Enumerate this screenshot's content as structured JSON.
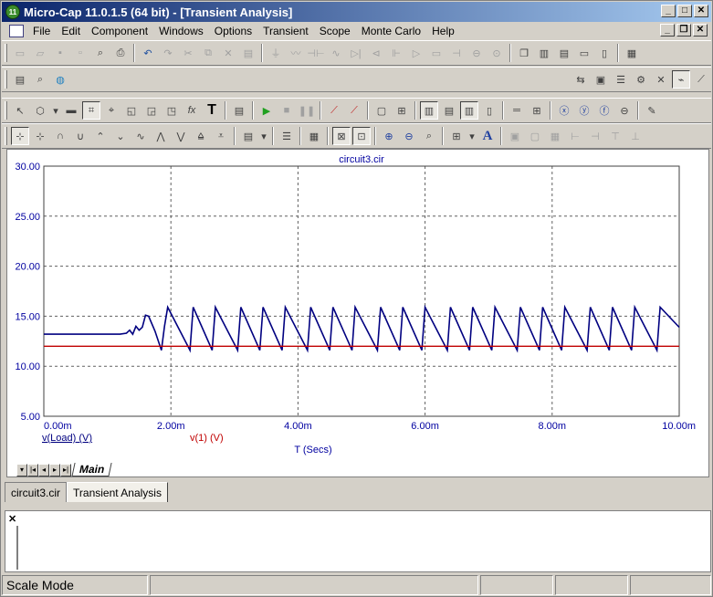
{
  "window": {
    "title": "Micro-Cap 11.0.1.5 (64 bit) - [Transient Analysis]",
    "app_icon_text": "11"
  },
  "menu": {
    "items": [
      "File",
      "Edit",
      "Component",
      "Windows",
      "Options",
      "Transient",
      "Scope",
      "Monte Carlo",
      "Help"
    ]
  },
  "plot": {
    "title": "circuit3.cir",
    "x_axis_label": "T (Secs)",
    "y_ticks": [
      "30.00",
      "25.00",
      "20.00",
      "15.00",
      "10.00",
      "5.00"
    ],
    "x_ticks": [
      "0.00m",
      "2.00m",
      "4.00m",
      "6.00m",
      "8.00m",
      "10.00m"
    ],
    "legend": [
      {
        "label": "v(Load) (V)",
        "color": "#000080"
      },
      {
        "label": "v(1) (V)",
        "color": "#c00000"
      }
    ],
    "tab_label": "Main"
  },
  "chart_data": {
    "type": "line",
    "title": "circuit3.cir",
    "xlabel": "T (Secs)",
    "ylabel": "",
    "xlim": [
      0,
      10
    ],
    "ylim": [
      5,
      30
    ],
    "x_unit": "ms",
    "grid": true,
    "series": [
      {
        "name": "v(Load) (V)",
        "color": "#000080",
        "x": [
          0,
          1.2,
          1.3,
          1.35,
          1.4,
          1.45,
          1.5,
          1.55,
          1.6,
          1.65,
          1.75,
          1.85,
          1.9,
          1.95,
          2.3,
          2.35,
          2.65,
          2.7,
          3.05,
          3.1,
          3.4,
          3.45,
          3.75,
          3.8,
          4.15,
          4.2,
          4.5,
          4.55,
          4.85,
          4.9,
          5.25,
          5.3,
          5.6,
          5.65,
          5.95,
          6.0,
          6.35,
          6.4,
          6.7,
          6.75,
          7.05,
          7.1,
          7.45,
          7.5,
          7.8,
          7.85,
          8.15,
          8.2,
          8.55,
          8.6,
          8.9,
          8.95,
          9.25,
          9.3,
          9.65,
          9.7,
          10.0
        ],
        "values": [
          13.2,
          13.2,
          13.3,
          13.6,
          13.2,
          14.0,
          13.6,
          13.9,
          15.1,
          15.0,
          13.5,
          11.6,
          14.0,
          15.9,
          11.6,
          15.9,
          11.6,
          15.9,
          11.6,
          15.9,
          11.6,
          15.9,
          11.6,
          15.9,
          11.6,
          15.9,
          11.6,
          15.9,
          11.6,
          15.9,
          11.6,
          15.9,
          11.6,
          15.9,
          11.6,
          15.9,
          11.6,
          15.9,
          11.6,
          15.9,
          11.6,
          15.9,
          11.6,
          15.9,
          11.6,
          15.9,
          11.6,
          15.9,
          11.6,
          15.9,
          11.6,
          15.9,
          11.6,
          15.9,
          11.6,
          15.9,
          13.9
        ]
      },
      {
        "name": "v(1) (V)",
        "color": "#c00000",
        "x": [
          0,
          10
        ],
        "values": [
          12.0,
          12.0
        ]
      }
    ]
  },
  "tabs": {
    "items": [
      "circuit3.cir",
      "Transient Analysis"
    ],
    "active_index": 1
  },
  "status": {
    "mode": "Scale Mode"
  }
}
